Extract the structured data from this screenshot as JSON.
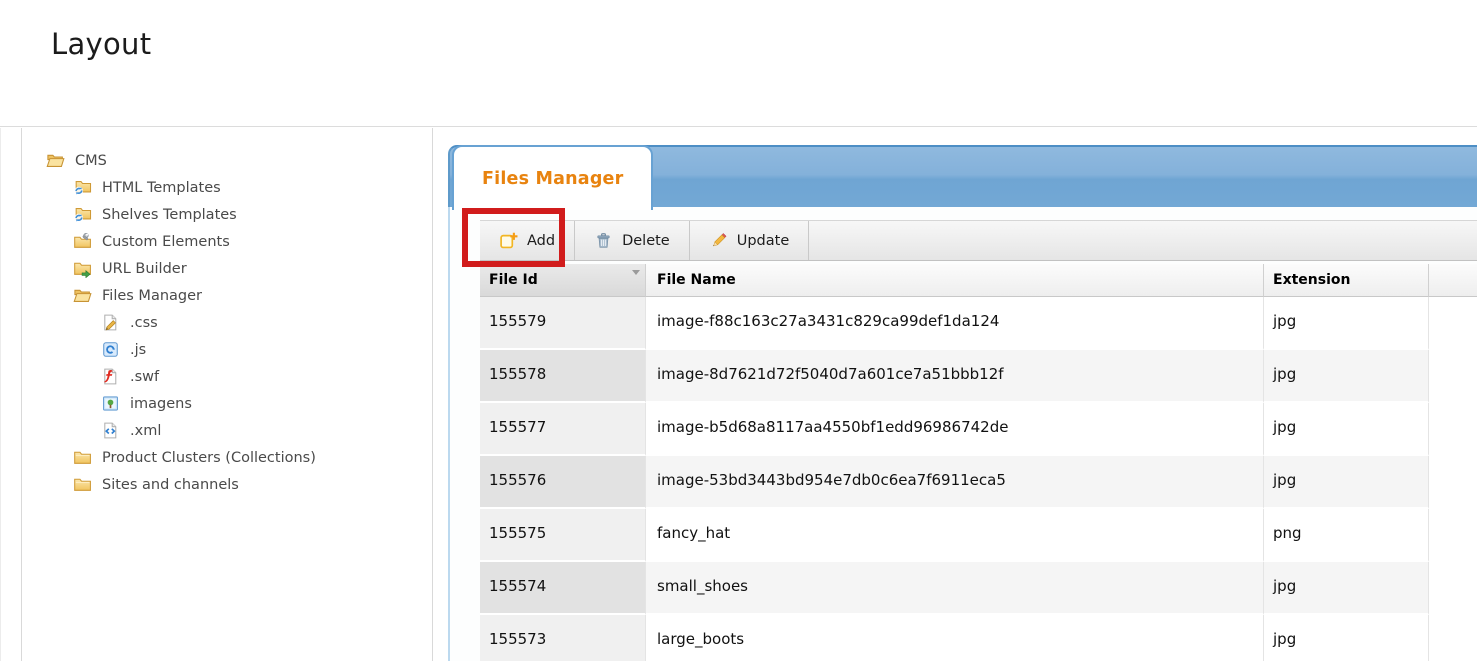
{
  "header": {
    "title": "Layout"
  },
  "tree": {
    "items": [
      {
        "label": "CMS",
        "level": 1,
        "icon": "folder-open-icon"
      },
      {
        "label": "HTML Templates",
        "level": 2,
        "icon": "folder-sync-icon"
      },
      {
        "label": "Shelves Templates",
        "level": 2,
        "icon": "folder-sync-icon"
      },
      {
        "label": "Custom Elements",
        "level": 2,
        "icon": "folder-tool-icon"
      },
      {
        "label": "URL Builder",
        "level": 2,
        "icon": "folder-arrow-icon"
      },
      {
        "label": "Files Manager",
        "level": 2,
        "icon": "folder-open-icon"
      },
      {
        "label": ".css",
        "level": 3,
        "icon": "file-css-icon"
      },
      {
        "label": ".js",
        "level": 3,
        "icon": "file-js-icon"
      },
      {
        "label": ".swf",
        "level": 3,
        "icon": "file-swf-icon"
      },
      {
        "label": "imagens",
        "level": 3,
        "icon": "file-image-icon"
      },
      {
        "label": ".xml",
        "level": 3,
        "icon": "file-xml-icon"
      },
      {
        "label": "Product Clusters (Collections)",
        "level": 2,
        "icon": "folder-closed-icon"
      },
      {
        "label": "Sites and channels",
        "level": 2,
        "icon": "folder-closed-icon"
      }
    ]
  },
  "panel": {
    "tab_label": "Files Manager"
  },
  "toolbar": {
    "buttons": [
      {
        "label": "Add",
        "icon": "note-add-icon",
        "highlighted": true
      },
      {
        "label": "Delete",
        "icon": "trash-icon"
      },
      {
        "label": "Update",
        "icon": "pencil-icon"
      }
    ]
  },
  "grid": {
    "columns": [
      {
        "label": "File Id",
        "sorted": true,
        "sort_direction": "desc"
      },
      {
        "label": "File Name"
      },
      {
        "label": "Extension"
      },
      {
        "label": ""
      }
    ],
    "rows": [
      {
        "file_id": "155579",
        "file_name": "image-f88c163c27a3431c829ca99def1da124",
        "extension": "jpg"
      },
      {
        "file_id": "155578",
        "file_name": "image-8d7621d72f5040d7a601ce7a51bbb12f",
        "extension": "jpg"
      },
      {
        "file_id": "155577",
        "file_name": "image-b5d68a8117aa4550bf1edd96986742de",
        "extension": "jpg"
      },
      {
        "file_id": "155576",
        "file_name": "image-53bd3443bd954e7db0c6ea7f6911eca5",
        "extension": "jpg"
      },
      {
        "file_id": "155575",
        "file_name": "fancy_hat",
        "extension": "png"
      },
      {
        "file_id": "155574",
        "file_name": "small_shoes",
        "extension": "jpg"
      },
      {
        "file_id": "155573",
        "file_name": "large_boots",
        "extension": "jpg"
      }
    ]
  },
  "annotation": {
    "type": "highlight-box",
    "target": "add-button",
    "color": "#d11c1c"
  },
  "colors": {
    "tab_text": "#e8830f",
    "panel_bar_top": "#8fb9de",
    "panel_bar_bottom": "#73a8d5",
    "annotation_red": "#d11c1c"
  }
}
